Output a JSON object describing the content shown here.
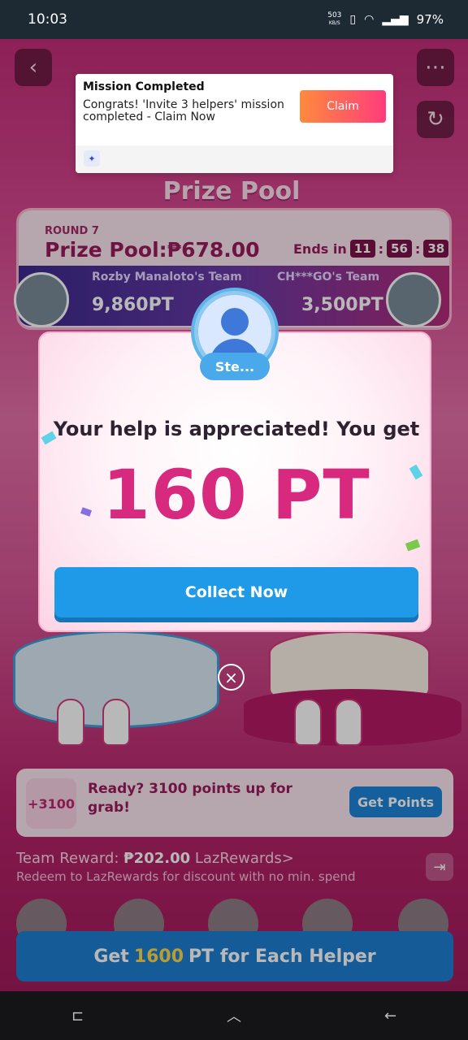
{
  "status_bar": {
    "time": "10:03",
    "net_speed": "503",
    "net_unit": "KB/S",
    "battery": "97%"
  },
  "game": {
    "prize_pool_heading": "Prize Pool",
    "round_label": "ROUND 7",
    "pool_amount": "Prize Pool:₱678.00",
    "ends_in_label": "Ends in",
    "timer": {
      "h": "11",
      "m": "56",
      "s": "38"
    },
    "team_left": {
      "name": "Rozby Manaloto's Team",
      "points": "9,860PT"
    },
    "team_right": {
      "name": "CH***GO's Team",
      "points": "3,500PT"
    },
    "points_card": {
      "tile": "+3100",
      "text": "Ready? 3100 points up for grab!",
      "button": "Get Points"
    },
    "team_reward_label": "Team Reward:",
    "team_reward_amount": "₱202.00",
    "team_reward_link": "LazRewards>",
    "redeem_text": "Redeem to LazRewards for discount with no min. spend",
    "helper_cta": {
      "prefix": "Get",
      "amount": "1600",
      "suffix": "PT for Each Helper"
    }
  },
  "notification": {
    "title": "Mission Completed",
    "body": "Congrats! 'Invite 3 helpers' mission completed - Claim Now",
    "claim_label": "Claim"
  },
  "modal": {
    "helper_name": "Ste...",
    "message": "Your help is appreciated! You get",
    "amount": "160 PT",
    "collect_label": "Collect Now"
  },
  "colors": {
    "accent_pink": "#d7297e",
    "button_blue": "#1f9ae8",
    "claim_gradient_start": "#ff8a3d",
    "claim_gradient_end": "#ff3c7c"
  }
}
